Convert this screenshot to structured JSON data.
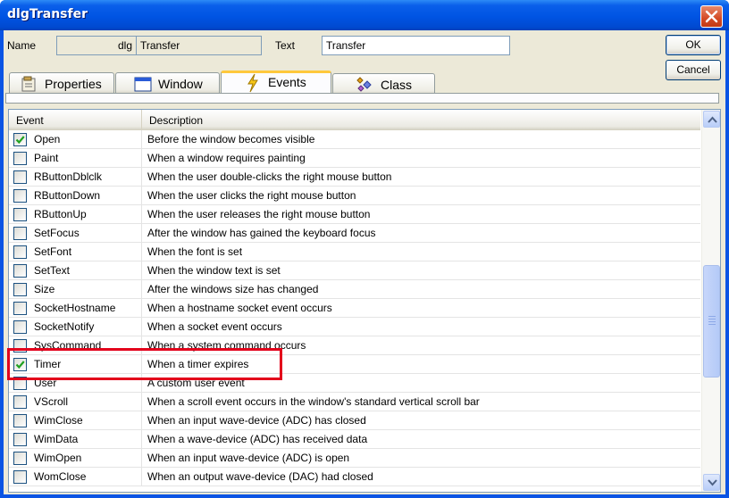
{
  "window": {
    "title": "dlgTransfer"
  },
  "form": {
    "name_label": "Name",
    "name_prefix": "dlg",
    "name_value": "Transfer",
    "text_label": "Text",
    "text_value": "Transfer"
  },
  "buttons": {
    "ok": "OK",
    "cancel": "Cancel"
  },
  "tabs": [
    {
      "label": "Properties",
      "icon": "properties-icon",
      "active": false
    },
    {
      "label": "Window",
      "icon": "window-icon",
      "active": false
    },
    {
      "label": "Events",
      "icon": "lightning-icon",
      "active": true
    },
    {
      "label": "Class",
      "icon": "class-icon",
      "active": false
    }
  ],
  "list": {
    "headers": {
      "event": "Event",
      "description": "Description"
    },
    "rows": [
      {
        "event": "Open",
        "description": "Before the window becomes visible",
        "checked": true
      },
      {
        "event": "Paint",
        "description": "When a window requires painting",
        "checked": false
      },
      {
        "event": "RButtonDblclk",
        "description": "When the user double-clicks the right mouse button",
        "checked": false
      },
      {
        "event": "RButtonDown",
        "description": "When the user clicks the right mouse button",
        "checked": false
      },
      {
        "event": "RButtonUp",
        "description": "When the user releases the right mouse button",
        "checked": false
      },
      {
        "event": "SetFocus",
        "description": "After the window has gained the keyboard focus",
        "checked": false
      },
      {
        "event": "SetFont",
        "description": "When the font is set",
        "checked": false
      },
      {
        "event": "SetText",
        "description": "When the window text is set",
        "checked": false
      },
      {
        "event": "Size",
        "description": "After the windows size has changed",
        "checked": false
      },
      {
        "event": "SocketHostname",
        "description": "When a hostname socket event occurs",
        "checked": false
      },
      {
        "event": "SocketNotify",
        "description": "When a socket event occurs",
        "checked": false
      },
      {
        "event": "SysCommand",
        "description": "When a system command occurs",
        "checked": false
      },
      {
        "event": "Timer",
        "description": "When a timer expires",
        "checked": true
      },
      {
        "event": "User",
        "description": "A custom user event",
        "checked": false
      },
      {
        "event": "VScroll",
        "description": "When a scroll event occurs in the window's standard vertical scroll bar",
        "checked": false
      },
      {
        "event": "WimClose",
        "description": "When an input wave-device (ADC) has closed",
        "checked": false
      },
      {
        "event": "WimData",
        "description": "When a wave-device (ADC) has received data",
        "checked": false
      },
      {
        "event": "WimOpen",
        "description": "When an input wave-device (ADC) is open",
        "checked": false
      },
      {
        "event": "WomClose",
        "description": "When an output wave-device (DAC) had closed",
        "checked": false
      }
    ]
  },
  "colors": {
    "highlight": "#E3001B",
    "title_bar": "#0054E3",
    "dialog_bg": "#ECE9D8"
  }
}
